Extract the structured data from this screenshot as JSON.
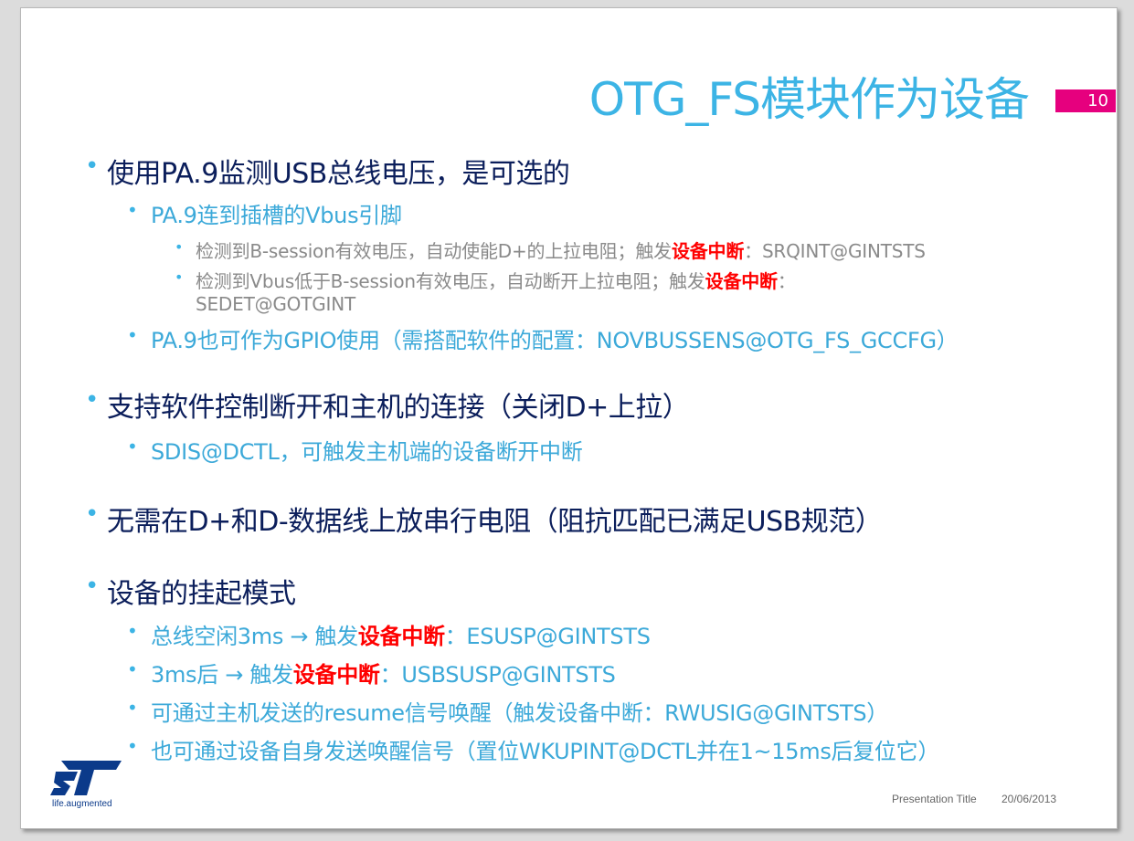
{
  "title": "OTG_FS模块作为设备",
  "page_number": "10",
  "bullets": {
    "b1": "使用PA.9监测USB总线电压，是可选的",
    "b1_1": "PA.9连到插槽的Vbus引脚",
    "b1_1_1_pre": "检测到B-session有效电压，自动使能D+的上拉电阻；触发",
    "b1_1_1_red": "设备中断",
    "b1_1_1_post": "：SRQINT@GINTSTS",
    "b1_1_2_pre": "检测到Vbus低于B-session有效电压，自动断开上拉电阻；触发",
    "b1_1_2_red": "设备中断",
    "b1_1_2_post": "：",
    "b1_1_2_cont": "SEDET@GOTGINT",
    "b1_2": "PA.9也可作为GPIO使用（需搭配软件的配置：NOVBUSSENS@OTG_FS_GCCFG）",
    "b2": "支持软件控制断开和主机的连接（关闭D+上拉）",
    "b2_1": "SDIS@DCTL，可触发主机端的设备断开中断",
    "b3": "无需在D+和D-数据线上放串行电阻（阻抗匹配已满足USB规范）",
    "b4": "设备的挂起模式",
    "b4_1_pre": "总线空闲3ms → 触发",
    "b4_1_red": "设备中断",
    "b4_1_post": "：ESUSP@GINTSTS",
    "b4_2_pre": "3ms后 → 触发",
    "b4_2_red": "设备中断",
    "b4_2_post": "：USBSUSP@GINTSTS",
    "b4_3": "可通过主机发送的resume信号唤醒（触发设备中断：RWUSIG@GINTSTS）",
    "b4_4": "也可通过设备自身发送唤醒信号（置位WKUPINT@DCTL并在1~15ms后复位它）"
  },
  "bullet_char": "•",
  "footer": {
    "presentation_title": "Presentation Title",
    "date": "20/06/2013"
  },
  "logo": {
    "tagline": "life.augmented",
    "icon": "st-logo-icon"
  },
  "colors": {
    "title": "#3cb4e5",
    "level1": "#0b1e5b",
    "level2": "#3ca9d9",
    "level3": "#8a8a8a",
    "highlight": "#ff0000",
    "page_box": "#e6007e"
  }
}
